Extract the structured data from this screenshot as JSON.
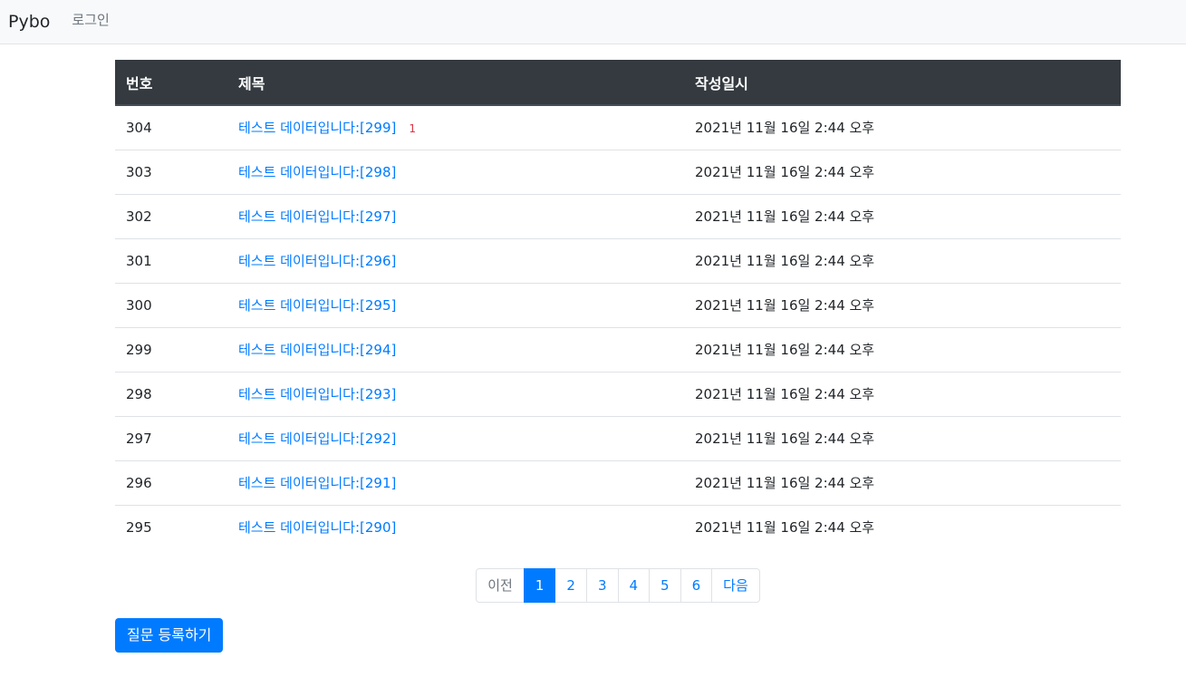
{
  "navbar": {
    "brand": "Pybo",
    "login_label": "로그인"
  },
  "table": {
    "headers": {
      "number": "번호",
      "subject": "제목",
      "created": "작성일시"
    },
    "rows": [
      {
        "number": "304",
        "subject": "테스트 데이터입니다:[299]",
        "answers": "1",
        "created": "2021년 11월 16일 2:44 오후"
      },
      {
        "number": "303",
        "subject": "테스트 데이터입니다:[298]",
        "answers": "",
        "created": "2021년 11월 16일 2:44 오후"
      },
      {
        "number": "302",
        "subject": "테스트 데이터입니다:[297]",
        "answers": "",
        "created": "2021년 11월 16일 2:44 오후"
      },
      {
        "number": "301",
        "subject": "테스트 데이터입니다:[296]",
        "answers": "",
        "created": "2021년 11월 16일 2:44 오후"
      },
      {
        "number": "300",
        "subject": "테스트 데이터입니다:[295]",
        "answers": "",
        "created": "2021년 11월 16일 2:44 오후"
      },
      {
        "number": "299",
        "subject": "테스트 데이터입니다:[294]",
        "answers": "",
        "created": "2021년 11월 16일 2:44 오후"
      },
      {
        "number": "298",
        "subject": "테스트 데이터입니다:[293]",
        "answers": "",
        "created": "2021년 11월 16일 2:44 오후"
      },
      {
        "number": "297",
        "subject": "테스트 데이터입니다:[292]",
        "answers": "",
        "created": "2021년 11월 16일 2:44 오후"
      },
      {
        "number": "296",
        "subject": "테스트 데이터입니다:[291]",
        "answers": "",
        "created": "2021년 11월 16일 2:44 오후"
      },
      {
        "number": "295",
        "subject": "테스트 데이터입니다:[290]",
        "answers": "",
        "created": "2021년 11월 16일 2:44 오후"
      }
    ]
  },
  "pagination": {
    "prev_label": "이전",
    "next_label": "다음",
    "pages": [
      "1",
      "2",
      "3",
      "4",
      "5",
      "6"
    ],
    "active_page": "1"
  },
  "actions": {
    "create_question_label": "질문 등록하기"
  },
  "colors": {
    "primary": "#007bff",
    "header_dark": "#343a40",
    "answer_count": "#dc3545",
    "navbar_bg": "#f8f9fa"
  }
}
